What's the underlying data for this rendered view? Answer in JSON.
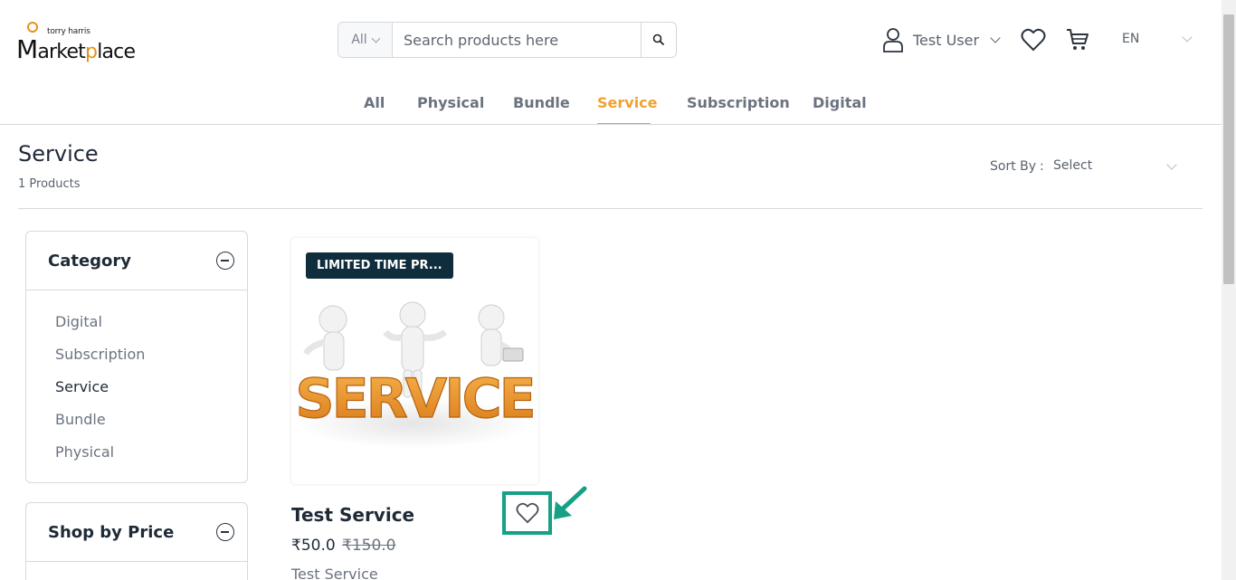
{
  "header": {
    "logo_small": "torry harris",
    "logo_main_a": "arket",
    "logo_main_b": "p",
    "logo_main_c": "lace",
    "logo_letter": "M",
    "search_category": "All",
    "search_placeholder": "Search products here",
    "user_name": "Test User",
    "language": "EN"
  },
  "nav": {
    "tabs": [
      {
        "label": "All"
      },
      {
        "label": "Physical"
      },
      {
        "label": "Bundle"
      },
      {
        "label": "Service"
      },
      {
        "label": "Subscription"
      },
      {
        "label": "Digital"
      }
    ],
    "active": "Service"
  },
  "page": {
    "title": "Service",
    "count": "1 Products",
    "sort_label": "Sort By",
    "sort_colon": ":",
    "sort_value": "Select"
  },
  "filters": {
    "category_title": "Category",
    "categories": [
      {
        "label": "Digital"
      },
      {
        "label": "Subscription"
      },
      {
        "label": "Service"
      },
      {
        "label": "Bundle"
      },
      {
        "label": "Physical"
      }
    ],
    "price_title": "Shop by Price"
  },
  "product": {
    "badge": "LIMITED TIME PR...",
    "image_text": "SERVICE",
    "name": "Test Service",
    "price": "₹50.0",
    "original_price": "₹150.0",
    "subtitle": "Test Service"
  },
  "colors": {
    "accent": "#f0a22f",
    "badge_bg": "#0f2d3c",
    "highlight": "#16a085"
  }
}
